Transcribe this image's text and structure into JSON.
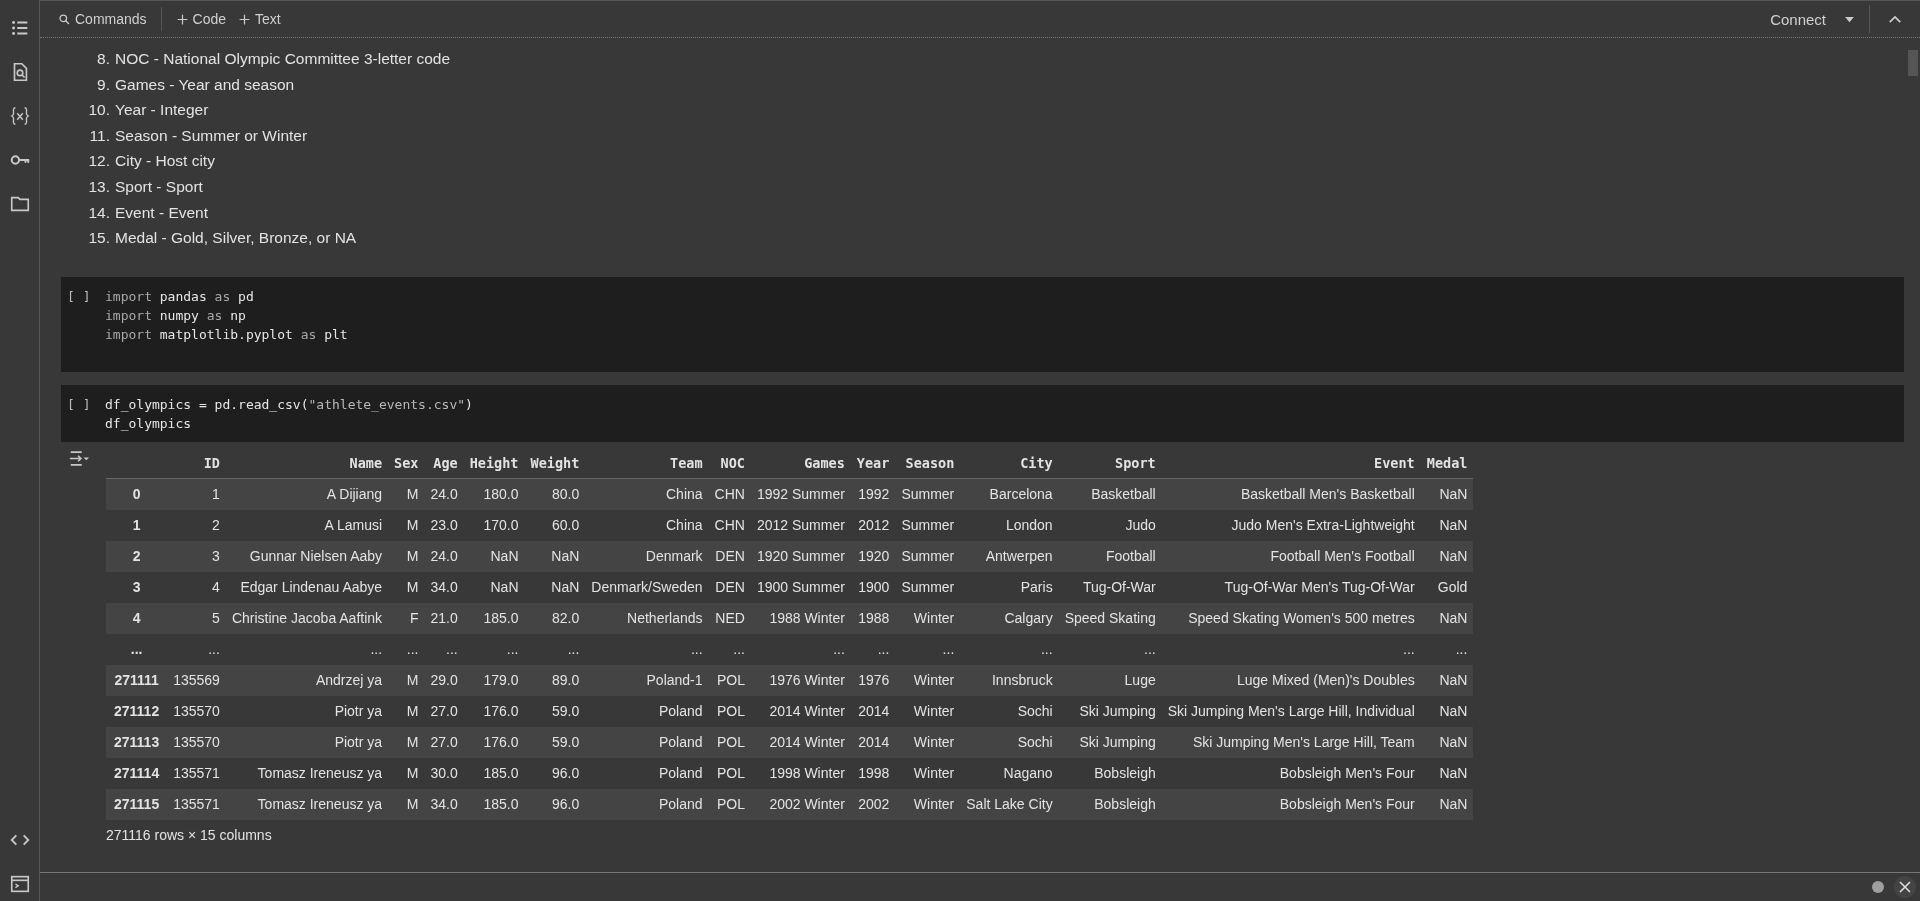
{
  "toolbar": {
    "commands": "Commands",
    "add_code": "Code",
    "add_text": "Text",
    "connect": "Connect"
  },
  "markdown_list": [
    {
      "number": "8.",
      "text": "NOC - National Olympic Committee 3-letter code"
    },
    {
      "number": "9.",
      "text": "Games - Year and season"
    },
    {
      "number": "10.",
      "text": "Year - Integer"
    },
    {
      "number": "11.",
      "text": "Season - Summer or Winter"
    },
    {
      "number": "12.",
      "text": "City - Host city"
    },
    {
      "number": "13.",
      "text": "Sport - Sport"
    },
    {
      "number": "14.",
      "text": "Event - Event"
    },
    {
      "number": "15.",
      "text": "Medal - Gold, Silver, Bronze, or NA"
    }
  ],
  "code_cells": [
    {
      "run_marker": "[ ]",
      "lines": [
        [
          {
            "t": "import",
            "kind": "keyword"
          },
          {
            "t": " pandas ",
            "kind": "name"
          },
          {
            "t": "as",
            "kind": "keyword"
          },
          {
            "t": " pd",
            "kind": "name"
          }
        ],
        [
          {
            "t": "import",
            "kind": "keyword"
          },
          {
            "t": " numpy ",
            "kind": "name"
          },
          {
            "t": "as",
            "kind": "keyword"
          },
          {
            "t": " np",
            "kind": "name"
          }
        ],
        [
          {
            "t": "import",
            "kind": "keyword"
          },
          {
            "t": " matplotlib.pyplot ",
            "kind": "name"
          },
          {
            "t": "as",
            "kind": "keyword"
          },
          {
            "t": " plt",
            "kind": "name"
          }
        ]
      ],
      "tall": true
    },
    {
      "run_marker": "[ ]",
      "lines": [
        [
          {
            "t": "df_olympics = pd.read_csv(",
            "kind": "name"
          },
          {
            "t": "\"athlete_events.csv\"",
            "kind": "string"
          },
          {
            "t": ")",
            "kind": "name"
          }
        ],
        [
          {
            "t": "df_olympics",
            "kind": "name"
          }
        ]
      ],
      "tall": false
    }
  ],
  "table": {
    "columns": [
      "ID",
      "Name",
      "Sex",
      "Age",
      "Height",
      "Weight",
      "Team",
      "NOC",
      "Games",
      "Year",
      "Season",
      "City",
      "Sport",
      "Event",
      "Medal"
    ],
    "rows": [
      {
        "index": "0",
        "cells": [
          "1",
          "A Dijiang",
          "M",
          "24.0",
          "180.0",
          "80.0",
          "China",
          "CHN",
          "1992 Summer",
          "1992",
          "Summer",
          "Barcelona",
          "Basketball",
          "Basketball Men's Basketball",
          "NaN"
        ]
      },
      {
        "index": "1",
        "cells": [
          "2",
          "A Lamusi",
          "M",
          "23.0",
          "170.0",
          "60.0",
          "China",
          "CHN",
          "2012 Summer",
          "2012",
          "Summer",
          "London",
          "Judo",
          "Judo Men's Extra-Lightweight",
          "NaN"
        ]
      },
      {
        "index": "2",
        "cells": [
          "3",
          "Gunnar Nielsen Aaby",
          "M",
          "24.0",
          "NaN",
          "NaN",
          "Denmark",
          "DEN",
          "1920 Summer",
          "1920",
          "Summer",
          "Antwerpen",
          "Football",
          "Football Men's Football",
          "NaN"
        ]
      },
      {
        "index": "3",
        "cells": [
          "4",
          "Edgar Lindenau Aabye",
          "M",
          "34.0",
          "NaN",
          "NaN",
          "Denmark/Sweden",
          "DEN",
          "1900 Summer",
          "1900",
          "Summer",
          "Paris",
          "Tug-Of-War",
          "Tug-Of-War Men's Tug-Of-War",
          "Gold"
        ]
      },
      {
        "index": "4",
        "cells": [
          "5",
          "Christine Jacoba Aaftink",
          "F",
          "21.0",
          "185.0",
          "82.0",
          "Netherlands",
          "NED",
          "1988 Winter",
          "1988",
          "Winter",
          "Calgary",
          "Speed Skating",
          "Speed Skating Women's 500 metres",
          "NaN"
        ]
      },
      {
        "index": "...",
        "cells": [
          "...",
          "...",
          "...",
          "...",
          "...",
          "...",
          "...",
          "...",
          "...",
          "...",
          "...",
          "...",
          "...",
          "...",
          "..."
        ]
      },
      {
        "index": "271111",
        "cells": [
          "135569",
          "Andrzej ya",
          "M",
          "29.0",
          "179.0",
          "89.0",
          "Poland-1",
          "POL",
          "1976 Winter",
          "1976",
          "Winter",
          "Innsbruck",
          "Luge",
          "Luge Mixed (Men)'s Doubles",
          "NaN"
        ]
      },
      {
        "index": "271112",
        "cells": [
          "135570",
          "Piotr ya",
          "M",
          "27.0",
          "176.0",
          "59.0",
          "Poland",
          "POL",
          "2014 Winter",
          "2014",
          "Winter",
          "Sochi",
          "Ski Jumping",
          "Ski Jumping Men's Large Hill, Individual",
          "NaN"
        ]
      },
      {
        "index": "271113",
        "cells": [
          "135570",
          "Piotr ya",
          "M",
          "27.0",
          "176.0",
          "59.0",
          "Poland",
          "POL",
          "2014 Winter",
          "2014",
          "Winter",
          "Sochi",
          "Ski Jumping",
          "Ski Jumping Men's Large Hill, Team",
          "NaN"
        ]
      },
      {
        "index": "271114",
        "cells": [
          "135571",
          "Tomasz Ireneusz ya",
          "M",
          "30.0",
          "185.0",
          "96.0",
          "Poland",
          "POL",
          "1998 Winter",
          "1998",
          "Winter",
          "Nagano",
          "Bobsleigh",
          "Bobsleigh Men's Four",
          "NaN"
        ]
      },
      {
        "index": "271115",
        "cells": [
          "135571",
          "Tomasz Ireneusz ya",
          "M",
          "34.0",
          "185.0",
          "96.0",
          "Poland",
          "POL",
          "2002 Winter",
          "2002",
          "Winter",
          "Salt Lake City",
          "Bobsleigh",
          "Bobsleigh Men's Four",
          "NaN"
        ]
      }
    ],
    "summary": "271116 rows × 15 columns"
  }
}
